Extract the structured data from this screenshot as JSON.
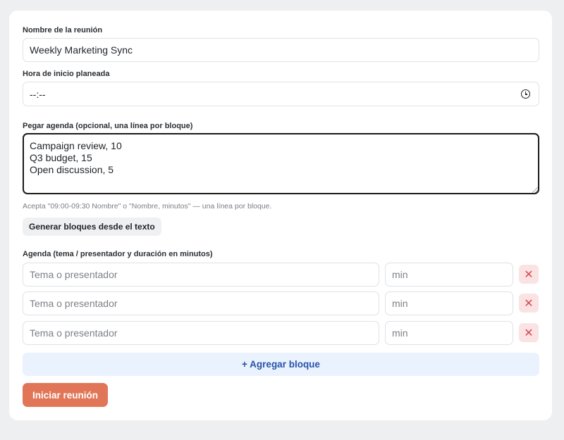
{
  "form": {
    "name_label": "Nombre de la reunión",
    "name_value": "Weekly Marketing Sync",
    "time_label": "Hora de inicio planeada",
    "time_value": "--:--",
    "time_icon": "clock-icon",
    "agenda_paste_label": "Pegar agenda (opcional, una línea por bloque)",
    "agenda_paste_value": "Campaign review, 10\nQ3 budget, 15\nOpen discussion, 5",
    "hint": "Acepta \"09:00-09:30 Nombre\" o \"Nombre, minutos\" — una línea por bloque.",
    "generate_button": "Generar bloques desde el texto",
    "agenda_label": "Agenda (tema / presentador y duración en minutos)",
    "rows": [
      {
        "topic_value": "",
        "topic_placeholder": "Tema o presentador",
        "minutes_value": "",
        "minutes_placeholder": "min",
        "delete_label": "✕"
      },
      {
        "topic_value": "",
        "topic_placeholder": "Tema o presentador",
        "minutes_value": "",
        "minutes_placeholder": "min",
        "delete_label": "✕"
      },
      {
        "topic_value": "",
        "topic_placeholder": "Tema o presentador",
        "minutes_value": "",
        "minutes_placeholder": "min",
        "delete_label": "✕"
      }
    ],
    "add_block_button": "+ Agregar bloque",
    "start_button": "Iniciar reunión"
  },
  "colors": {
    "accent_start": "#e07657",
    "add_block_bg": "#eaf2fe",
    "add_block_text": "#2753a8",
    "delete_bg": "#fbe3e4",
    "delete_text": "#d9494f"
  }
}
